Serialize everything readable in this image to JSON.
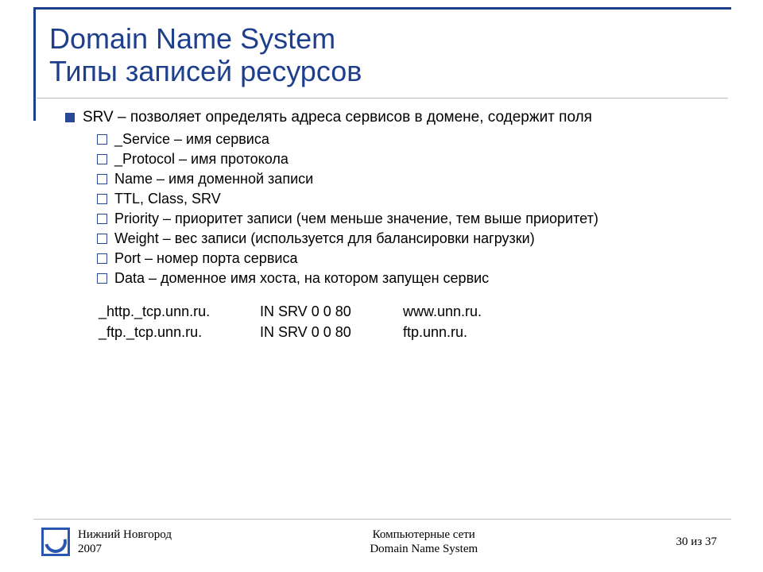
{
  "title": {
    "line1": "Domain Name System",
    "line2": "Типы записей ресурсов"
  },
  "bullet": {
    "main": "SRV – позволяет определять адреса сервисов в домене, содержит поля",
    "items": [
      "_Service – имя сервиса",
      "_Protocol – имя протокола",
      "Name – имя доменной записи",
      "TTL, Class, SRV",
      "Priority – приоритет записи (чем меньше значение, тем выше приоритет)",
      "Weight – вес записи (используется для балансировки нагрузки)",
      "Port – номер порта сервиса",
      "Data – доменное имя хоста, на котором запущен сервис"
    ]
  },
  "examples": [
    {
      "c1": "_http._tcp.unn.ru.",
      "c2": "IN SRV 0 0 80",
      "c3": "www.unn.ru."
    },
    {
      "c1": "_ftp._tcp.unn.ru.",
      "c2": "IN SRV 0 0 80",
      "c3": "ftp.unn.ru."
    }
  ],
  "footer": {
    "location": "Нижний Новгород",
    "year": "2007",
    "course": "Компьютерные сети",
    "topic": "Domain Name System",
    "page": "30 из 37"
  }
}
